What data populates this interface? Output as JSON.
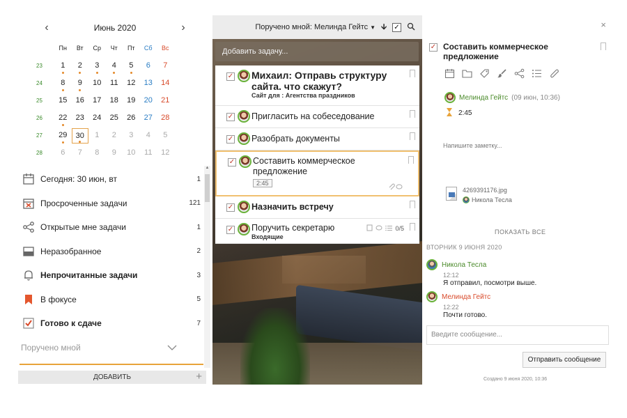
{
  "calendar": {
    "month_label": "Июнь 2020",
    "prev_icon": "chevron-left-icon",
    "next_icon": "chevron-right-icon",
    "weekday_headers": [
      "Пн",
      "Вт",
      "Ср",
      "Чт",
      "Пт",
      "Сб",
      "Вс"
    ],
    "weeks": [
      {
        "num": "23",
        "days": [
          "1",
          "2",
          "3",
          "4",
          "5",
          "6",
          "7"
        ]
      },
      {
        "num": "24",
        "days": [
          "8",
          "9",
          "10",
          "11",
          "12",
          "13",
          "14"
        ]
      },
      {
        "num": "25",
        "days": [
          "15",
          "16",
          "17",
          "18",
          "19",
          "20",
          "21"
        ]
      },
      {
        "num": "26",
        "days": [
          "22",
          "23",
          "24",
          "25",
          "26",
          "27",
          "28"
        ]
      },
      {
        "num": "27",
        "days": [
          "29",
          "30",
          "1",
          "2",
          "3",
          "4",
          "5"
        ]
      },
      {
        "num": "28",
        "days": [
          "6",
          "7",
          "8",
          "9",
          "10",
          "11",
          "12"
        ]
      }
    ]
  },
  "sidebar": {
    "items": [
      {
        "label": "Сегодня: 30 июн, вт",
        "count": "1",
        "icon": "calendar-icon"
      },
      {
        "label": "Просроченные задачи",
        "count": "121",
        "icon": "calendar-x-icon"
      },
      {
        "label": "Открытые мне задачи",
        "count": "1",
        "icon": "share-icon"
      },
      {
        "label": "Неразобранное",
        "count": "2",
        "icon": "inbox-icon"
      },
      {
        "label": "Непрочитанные задачи",
        "count": "3",
        "icon": "bell-icon"
      },
      {
        "label": "В фокусе",
        "count": "5",
        "icon": "bookmark-icon"
      },
      {
        "label": "Готово к сдаче",
        "count": "7",
        "icon": "checkbox-icon"
      },
      {
        "label": "Поручено мной",
        "count": "",
        "icon": "chevron-down-icon"
      }
    ],
    "add_label": "ДОБАВИТЬ",
    "add_plus": "+"
  },
  "task_list": {
    "filter_label": "Поручено мной: Мелинда Гейтс",
    "add_placeholder": "Добавить задачу...",
    "tasks": [
      {
        "title": "Михаил: Отправь структуру сайта. что скажут?",
        "subtitle": "Сайт для : Агентства праздников"
      },
      {
        "title": "Пригласить на собеседование"
      },
      {
        "title": "Разобрать документы"
      },
      {
        "title": "Составить коммерческое предложение",
        "time": "2:45"
      },
      {
        "title": "Назначить встречу"
      },
      {
        "title": "Поручить секретарю",
        "subtitle": "Входящие",
        "checklist": "0/5"
      }
    ]
  },
  "detail": {
    "title": "Составить коммерческое предложение",
    "owner_name": "Мелинда Гейтс",
    "owner_date": "(09 июн, 10:36)",
    "time_spent": "2:45",
    "note_placeholder": "Напишите заметку...",
    "file_name": "4269391176.jpg",
    "file_owner": "Никола Тесла",
    "show_all": "ПОКАЗАТЬ ВСЕ",
    "day_header": "ВТОРНИК 9 ИЮНЯ 2020",
    "messages": [
      {
        "author": "Никола Тесла",
        "time": "12:12",
        "text": "Я отправил, посмотри выше."
      },
      {
        "author": "Мелинда Гейтс",
        "time": "12:22",
        "text": "Почти готово."
      }
    ],
    "message_placeholder": "Введите сообщение...",
    "send_label": "Отправить сообщение",
    "created": "Создано 9 июня 2020, 10:36",
    "close_glyph": "×"
  },
  "colors": {
    "accent_orange": "#e8a33a",
    "check_red": "#c0392b",
    "green": "#4a8a2a",
    "saturday_blue": "#2a7dc4",
    "sunday_red": "#d84a2a"
  }
}
